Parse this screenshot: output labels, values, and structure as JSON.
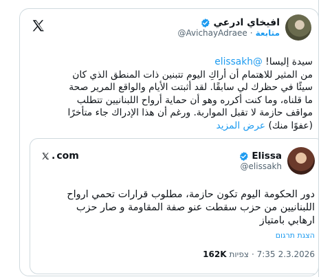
{
  "post": {
    "author_name": "افيخاي ادرعي",
    "handle": "@AvichayAdraee",
    "separator": "·",
    "follow_label": "متابعة",
    "body_lines": [
      {
        "prefix": "سيدة إليسا! ",
        "mention": "@elissakh",
        "suffix": ""
      },
      {
        "prefix": "من المثير للاهتمام أن أراكِ اليوم تتبنين ذات المنطق الذي كان",
        "mention": "",
        "suffix": ""
      },
      {
        "prefix": "سيئًا في حظرك لي سابقًا. لقد أثبتت الأيام والواقع المرير صحة",
        "mention": "",
        "suffix": ""
      },
      {
        "prefix": "ما قلناه، وما كنت أكرره وهو أن حماية أرواح اللبنانيين تتطلب",
        "mention": "",
        "suffix": ""
      },
      {
        "prefix": "مواقف حازمة لا تقبل المواربة. ورغم أن هذا الإدراك جاء متأخرًا",
        "mention": "",
        "suffix": ""
      }
    ],
    "last_line": "(عفوًا منك)",
    "show_more": "عرض المزيد"
  },
  "quote": {
    "source_label": "com",
    "author_name": "Elissa",
    "handle": "@elissakh",
    "lines": [
      "دور الحكومة اليوم تكون حازمة، مطلوب قرارات تحمي ارواح",
      "اللبنانيين من حزب سقطت عنو صفة المقاومة و صار حزب",
      "ارهابي بامتياز"
    ],
    "translate_label": "הצגת תרגום",
    "date": "2.3.2026",
    "time": "7:35 ·",
    "views_label": "צפיות",
    "views_count": "162K"
  },
  "colors": {
    "accent": "#1d9bf0",
    "text": "#0f1419",
    "muted": "#536471",
    "border": "#cfd9de"
  },
  "icons": {
    "platform": "x-logo-icon",
    "verified": "verified-badge-icon"
  }
}
